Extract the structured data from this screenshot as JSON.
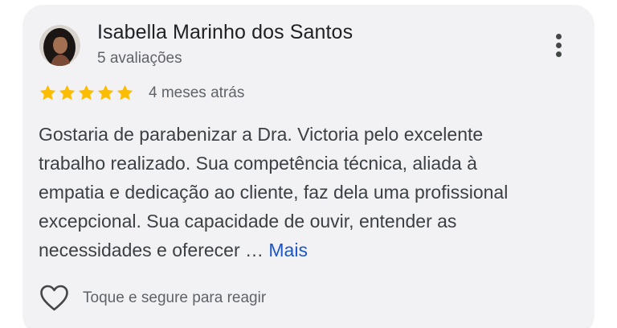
{
  "review": {
    "author_name": "Isabella Marinho dos Santos",
    "author_reviews": "5 avaliações",
    "rating": 5,
    "rating_max": 5,
    "time_ago": "4 meses atrás",
    "text_lines": [
      "Gostaria de parabenizar a Dra. Victoria pelo excelente",
      "trabalho realizado. Sua competência técnica, aliada à",
      "empatia e dedicação ao cliente, faz dela uma profissional",
      "excepcional. Sua capacidade de ouvir, entender as",
      "necessidades e oferecer … "
    ],
    "more_label": "Mais",
    "react_hint": "Toque e segure para reagir"
  },
  "icons": {
    "menu": "more-vert-icon",
    "star": "star-icon",
    "react": "heart-outline-icon"
  },
  "colors": {
    "star": "#fbbc04",
    "link": "#1a56c9",
    "card_background": "#f2f2f4"
  }
}
